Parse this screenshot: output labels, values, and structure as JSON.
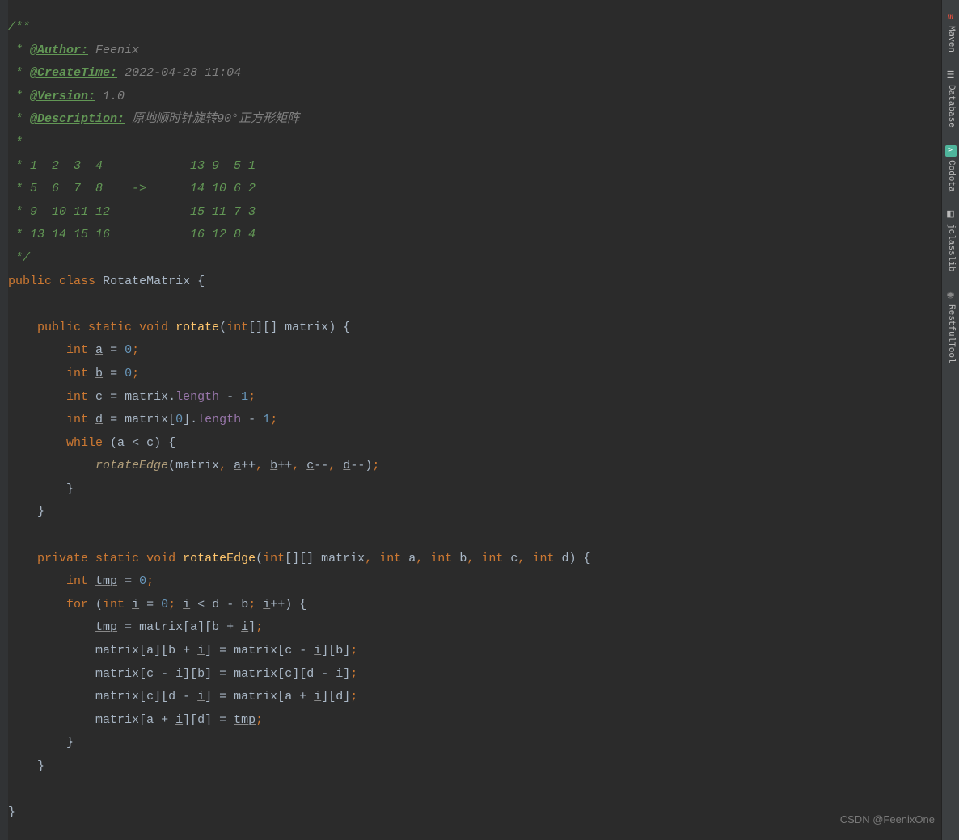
{
  "doc": {
    "open": "/**",
    "author_tag": "@Author:",
    "author": "Feenix",
    "create_tag": "@CreateTime:",
    "create": "2022-04-28 11:04",
    "version_tag": "@Version:",
    "version": "1.0",
    "desc_tag": "@Description:",
    "desc": "原地顺时针旋转90°正方形矩阵",
    "star": " *",
    "m1": " * 1  2  3  4            13 9  5 1",
    "m2": " * 5  6  7  8    ->      14 10 6 2",
    "m3": " * 9  10 11 12           15 11 7 3",
    "m4": " * 13 14 15 16           16 12 8 4",
    "close": " */"
  },
  "code": {
    "public": "public",
    "private": "private",
    "class": "class",
    "static": "static",
    "void": "void",
    "int": "int",
    "for": "for",
    "while": "while",
    "className": "RotateMatrix",
    "rotate": "rotate",
    "rotateEdge": "rotateEdge",
    "matrix": "matrix",
    "length": "length",
    "a": "a",
    "b": "b",
    "c": "c",
    "d": "d",
    "i": "i",
    "tmp": "tmp",
    "zero": "0",
    "one": "1"
  },
  "sidebar": {
    "items": [
      {
        "label": "Maven",
        "icon": "m"
      },
      {
        "label": "Database",
        "icon": "☰"
      },
      {
        "label": "Codota",
        "icon": ">"
      },
      {
        "label": "jclasslib",
        "icon": "◧"
      },
      {
        "label": "RestfulTool",
        "icon": "◉"
      }
    ]
  },
  "watermark": "CSDN @FeenixOne"
}
